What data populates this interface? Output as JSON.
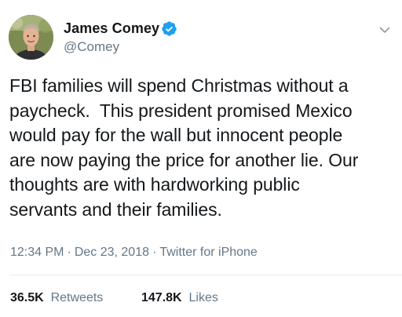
{
  "user": {
    "display_name": "James Comey",
    "handle": "@Comey",
    "verified_icon": "verified-badge-icon",
    "avatar": "avatar-photo"
  },
  "tweet": {
    "text": "FBI families will spend Christmas without a\npaycheck.  This president promised Mexico\nwould pay for the wall but innocent people\nare now paying the price for another lie. Our\nthoughts are with hardworking public\nservants and their families.",
    "time": "12:34 PM",
    "date": "Dec 23, 2018",
    "source": "Twitter for iPhone",
    "separator": "·"
  },
  "stats": {
    "retweets_count": "36.5K",
    "retweets_label": "Retweets",
    "likes_count": "147.8K",
    "likes_label": "Likes"
  },
  "colors": {
    "text": "#14171a",
    "secondary": "#657786",
    "verified": "#1da1f2",
    "divider": "#e6ecf0"
  }
}
